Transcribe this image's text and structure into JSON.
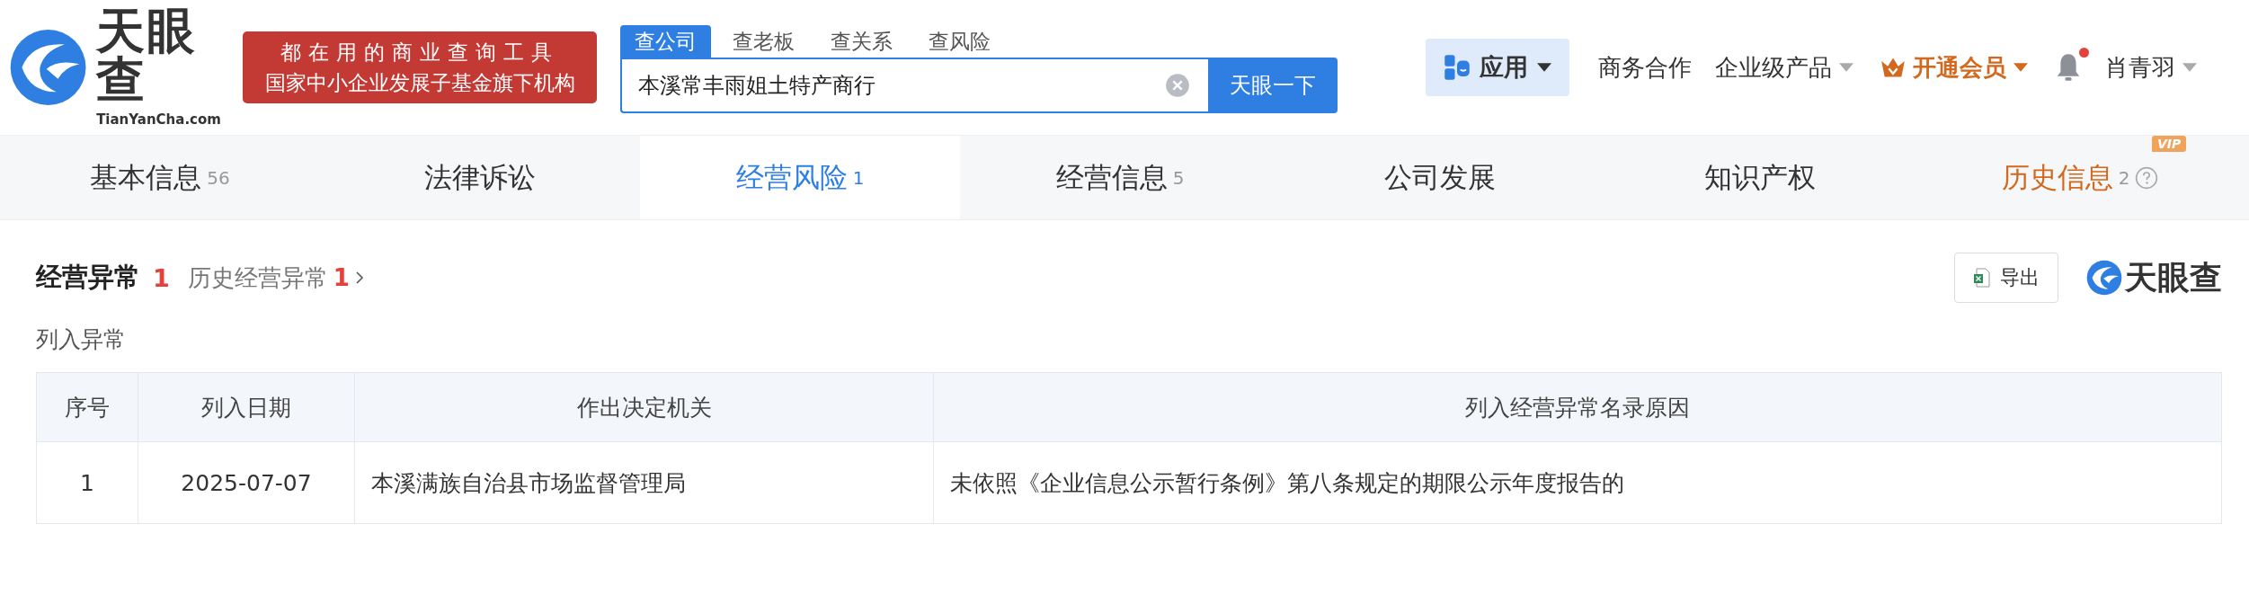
{
  "header": {
    "logo": {
      "name": "天眼查",
      "domain": "TianYanCha.com"
    },
    "banner": [
      "都在用的商业查询工具",
      "国家中小企业发展子基金旗下机构"
    ],
    "search": {
      "tabs": [
        {
          "label": "查公司",
          "selected": true
        },
        {
          "label": "查老板",
          "selected": false
        },
        {
          "label": "查关系",
          "selected": false
        },
        {
          "label": "查风险",
          "selected": false
        }
      ],
      "value": "本溪常丰雨姐土特产商行",
      "button": "天眼一下"
    },
    "nav": [
      {
        "kind": "apps",
        "label": "应用"
      },
      {
        "kind": "link",
        "label": "商务合作"
      },
      {
        "kind": "dropdown",
        "label": "企业级产品"
      },
      {
        "kind": "vip",
        "label": "开通会员"
      },
      {
        "kind": "bell",
        "unread": true
      },
      {
        "kind": "user",
        "label": "肖青羽"
      }
    ]
  },
  "tabs": [
    {
      "label": "基本信息",
      "count": "56",
      "selected": false,
      "kind": "normal"
    },
    {
      "label": "法律诉讼",
      "selected": false,
      "kind": "normal"
    },
    {
      "label": "经营风险",
      "count": "1",
      "selected": true,
      "kind": "normal"
    },
    {
      "label": "经营信息",
      "count": "5",
      "selected": false,
      "kind": "normal"
    },
    {
      "label": "公司发展",
      "selected": false,
      "kind": "normal"
    },
    {
      "label": "知识产权",
      "selected": false,
      "kind": "normal"
    },
    {
      "label": "历史信息",
      "count": "2",
      "selected": false,
      "kind": "vip",
      "badge": "VIP"
    }
  ],
  "section": {
    "title": "经营异常",
    "count": "1",
    "history_label": "历史经营异常",
    "history_count": "1",
    "export": "导出",
    "brand": "天眼查",
    "subtitle": "列入异常"
  },
  "table": {
    "columns": [
      "序号",
      "列入日期",
      "作出决定机关",
      "列入经营异常名录原因"
    ],
    "rows": [
      [
        "1",
        "2025-07-07",
        "本溪满族自治县市场监督管理局",
        "未依照《企业信息公示暂行条例》第八条规定的期限公示年度报告的"
      ]
    ]
  }
}
